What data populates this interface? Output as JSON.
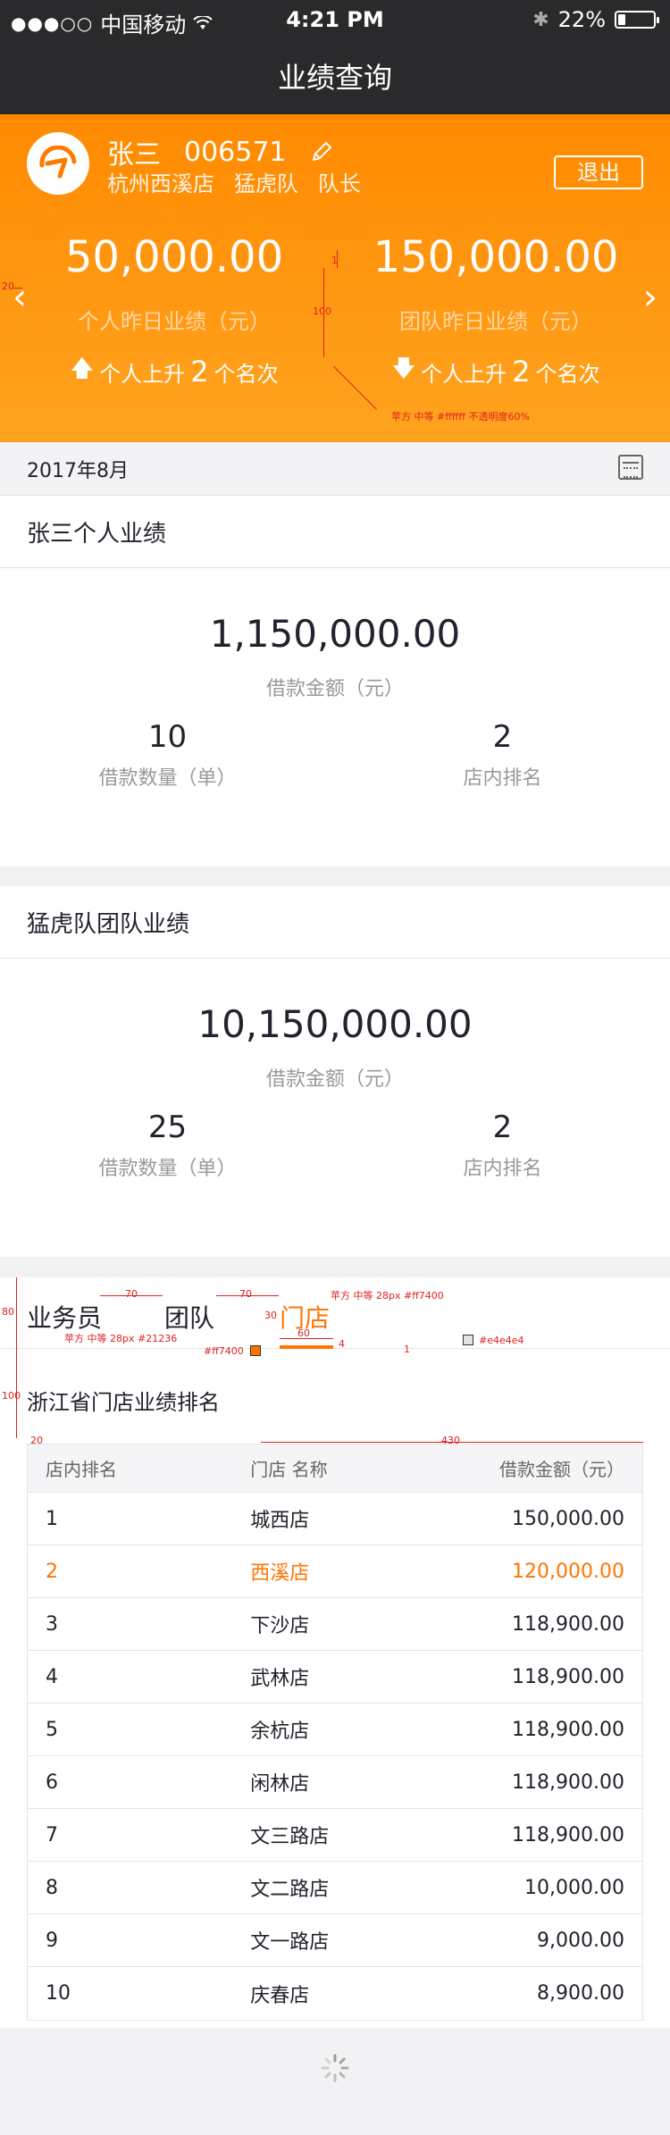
{
  "status": {
    "carrier": "中国移动",
    "time": "4:21 PM",
    "battery": "22%",
    "battery_level": 0.22
  },
  "nav": {
    "title": "业绩查询"
  },
  "profile": {
    "name": "张三",
    "id": "006571",
    "store": "杭州西溪店",
    "team": "猛虎队",
    "role": "队长",
    "logout_label": "退出"
  },
  "summary": {
    "personal_value": "50,000.00",
    "personal_caption": "个人昨日业绩（元）",
    "personal_rank_prefix": "个人上升",
    "personal_rank_num": "2",
    "personal_rank_suffix": "个名次",
    "team_value": "150,000.00",
    "team_caption": "团队昨日业绩（元）",
    "team_rank_prefix": "个人上升",
    "team_rank_num": "2",
    "team_rank_suffix": "个名次"
  },
  "annotations": {
    "a20": "20",
    "a1": "1",
    "a100": "100",
    "hero_font": "苹方  中等  #ffffff 不透明度60%",
    "a80": "80",
    "a70a": "70",
    "a70b": "70",
    "a30": "30",
    "tab_active_font": "苹方  中等  28px  #ff7400",
    "tab_font": "苹方  中等  28px  #21236",
    "color_ff7400": "#ff7400",
    "a60": "60",
    "a4": "4",
    "a1b": "1",
    "color_e4": "#e4e4e4",
    "a100b": "100",
    "a20b": "20",
    "a430": "430"
  },
  "date": {
    "label": "2017年8月"
  },
  "personal_card": {
    "title": "张三个人业绩",
    "amount": "1,150,000.00",
    "amount_caption": "借款金额（元）",
    "count": "10",
    "count_caption": "借款数量（单）",
    "rank": "2",
    "rank_caption": "店内排名"
  },
  "team_card": {
    "title": "猛虎队团队业绩",
    "amount": "10,150,000.00",
    "amount_caption": "借款金额（元）",
    "count": "25",
    "count_caption": "借款数量（单）",
    "rank": "2",
    "rank_caption": "店内排名"
  },
  "ranking": {
    "tabs": [
      "业务员",
      "团队",
      "门店"
    ],
    "active_tab": "门店",
    "title": "浙江省门店业绩排名",
    "headers": [
      "店内排名",
      "门店 名称",
      "借款金额（元）"
    ],
    "rows": [
      {
        "rank": "1",
        "store": "城西店",
        "amount": "150,000.00"
      },
      {
        "rank": "2",
        "store": "西溪店",
        "amount": "120,000.00"
      },
      {
        "rank": "3",
        "store": "下沙店",
        "amount": "118,900.00"
      },
      {
        "rank": "4",
        "store": "武林店",
        "amount": "118,900.00"
      },
      {
        "rank": "5",
        "store": "余杭店",
        "amount": "118,900.00"
      },
      {
        "rank": "6",
        "store": "闲林店",
        "amount": "118,900.00"
      },
      {
        "rank": "7",
        "store": "文三路店",
        "amount": "118,900.00"
      },
      {
        "rank": "8",
        "store": "文二路店",
        "amount": "10,000.00"
      },
      {
        "rank": "9",
        "store": "文一路店",
        "amount": "9,000.00"
      },
      {
        "rank": "10",
        "store": "庆春店",
        "amount": "8,900.00"
      }
    ]
  },
  "colors": {
    "accent": "#ff7400",
    "dark": "#21232d",
    "border": "#e4e4e4"
  }
}
